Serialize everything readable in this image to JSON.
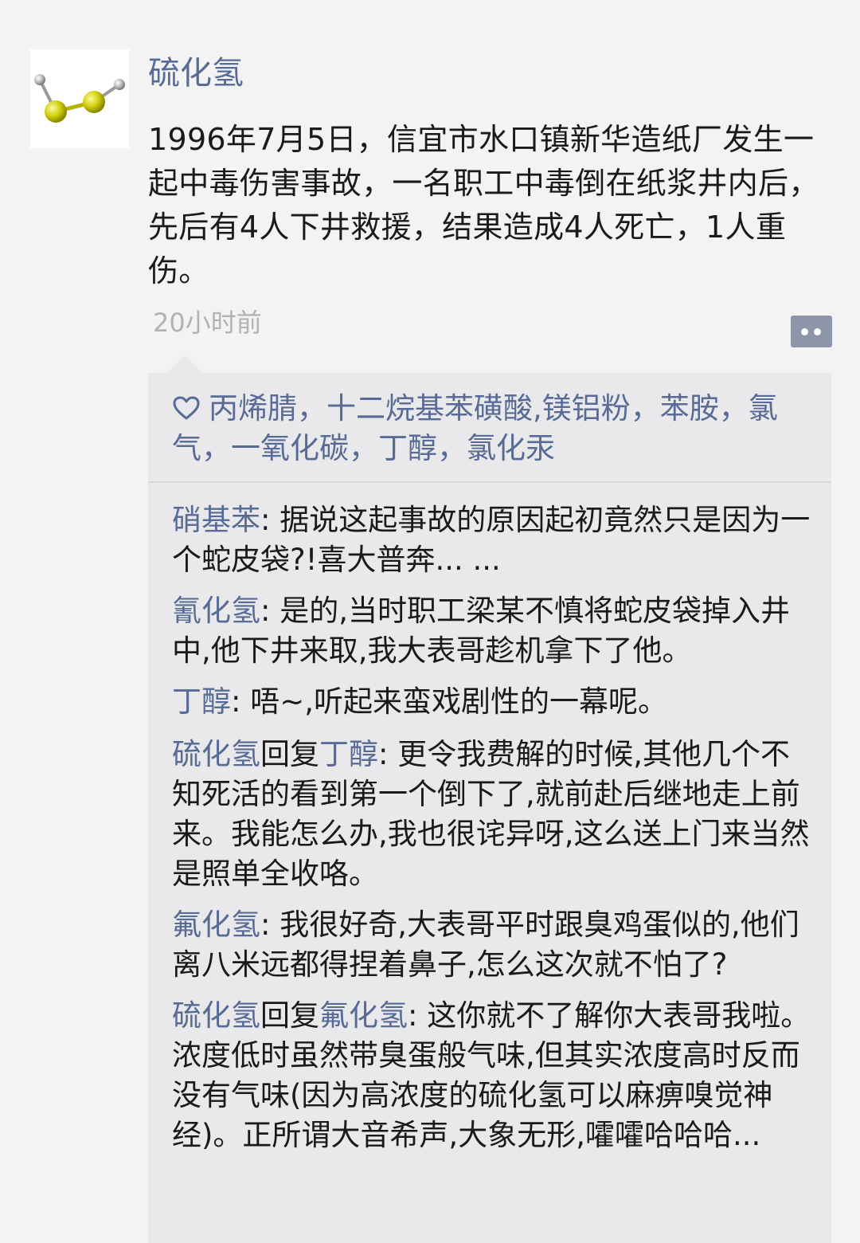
{
  "post": {
    "author": "硫化氢",
    "avatar_icon": "h2s-molecule-icon",
    "text": "1996年7月5日，信宜市水口镇新华造纸厂发生一起中毒伤害事故，一名职工中毒倒在纸浆井内后，先后有4人下井救援，结果造成4人死亡，1人重伤。",
    "timestamp": "20小时前",
    "more_icon": "more-dots-icon"
  },
  "likes": {
    "icon": "heart-icon",
    "text": "丙烯腈，十二烷基苯磺酸,镁铝粉，苯胺，氯气，一氧化碳，丁醇，氯化汞"
  },
  "comments": [
    {
      "author": "硝基苯",
      "colon": ": ",
      "text": "据说这起事故的原因起初竟然只是因为一个蛇皮袋?!喜大普奔... ..."
    },
    {
      "author": "氰化氢",
      "colon": ": ",
      "text": "是的,当时职工梁某不慎将蛇皮袋掉入井中,他下井来取,我大表哥趁机拿下了他。"
    },
    {
      "author": "丁醇",
      "colon": ": ",
      "text": "唔~,听起来蛮戏剧性的一幕呢。"
    },
    {
      "author": "硫化氢",
      "reply_word": "回复",
      "reply_to": "丁醇",
      "colon": ": ",
      "text": "更令我费解的时候,其他几个不知死活的看到第一个倒下了,就前赴后继地走上前来。我能怎么办,我也很诧异呀,这么送上门来当然是照单全收咯。"
    },
    {
      "author": "氟化氢",
      "colon": ": ",
      "text": "我很好奇,大表哥平时跟臭鸡蛋似的,他们离八米远都得捏着鼻子,怎么这次就不怕了?"
    },
    {
      "author": "硫化氢",
      "reply_word": "回复",
      "reply_to": "氟化氢",
      "colon": ": ",
      "text": "这你就不了解你大表哥我啦。浓度低时虽然带臭蛋般气味,但其实浓度高时反而没有气味(因为高浓度的硫化氢可以麻痹嗅觉神经)。正所谓大音希声,大象无形,嚯嚯哈哈哈..."
    }
  ]
}
